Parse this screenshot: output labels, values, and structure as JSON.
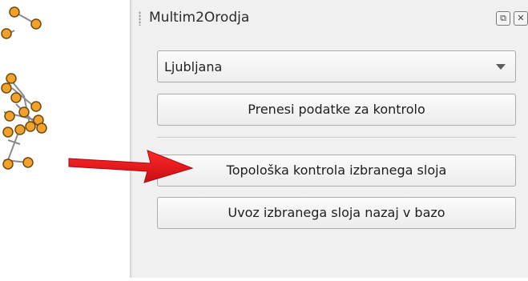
{
  "panel": {
    "title": "Multim2Orodja",
    "dock_buttons": [
      "restore-icon",
      "close-icon"
    ]
  },
  "combo": {
    "value": "Ljubljana"
  },
  "buttons": {
    "download_label": "Prenesi podatke za kontrolo",
    "topology_label": "Topološka kontrola izbranega sloja",
    "import_label": "Uvoz izbranega sloja nazaj v bazo"
  },
  "colors": {
    "arrow": "#e8141b",
    "node_fill": "#f2a12a",
    "node_stroke": "#6b4a10",
    "edge": "#8a8a8a",
    "panel_bg": "#f0f0f0"
  }
}
